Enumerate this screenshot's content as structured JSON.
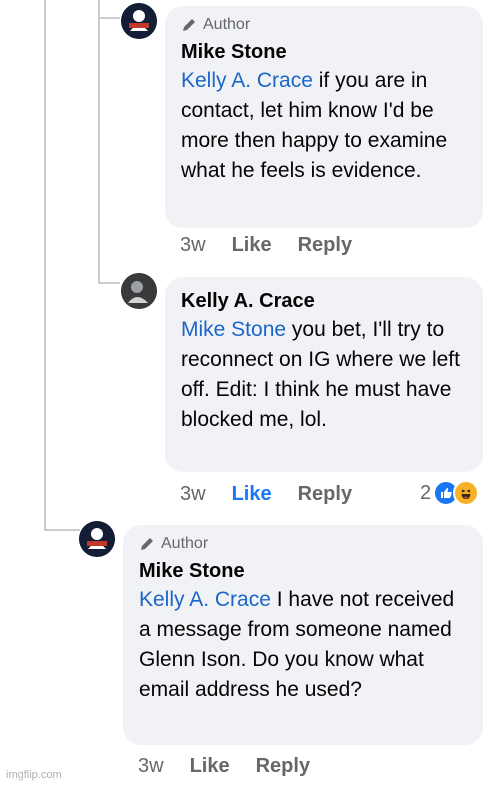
{
  "comments": [
    {
      "author_badge": "Author",
      "name": "Mike Stone",
      "mention": "Kelly A. Crace",
      "text": "if you are in contact, let him know I'd be more then happy to examine what he feels is evidence.",
      "time": "3w",
      "like_label": "Like",
      "reply_label": "Reply"
    },
    {
      "author_badge": "",
      "name": "Kelly A. Crace",
      "mention": "Mike Stone",
      "text": "you bet, I'll try to reconnect on IG where we left off. Edit: I think he must have blocked me, lol.",
      "time": "3w",
      "like_label": "Like",
      "reply_label": "Reply",
      "reaction_count": "2",
      "reactions": [
        "like-icon",
        "haha-icon"
      ]
    },
    {
      "author_badge": "Author",
      "name": "Mike Stone",
      "mention": "Kelly A. Crace",
      "text": "I have not received a message from someone named Glenn Ison. Do you know what email address he used?",
      "time": "3w",
      "like_label": "Like",
      "reply_label": "Reply"
    }
  ],
  "watermark": "imgflip.com",
  "colors": {
    "bubble": "#f0f2f5",
    "mention": "#1b66c9",
    "like_active": "#1877f2",
    "meta": "#65676b"
  }
}
